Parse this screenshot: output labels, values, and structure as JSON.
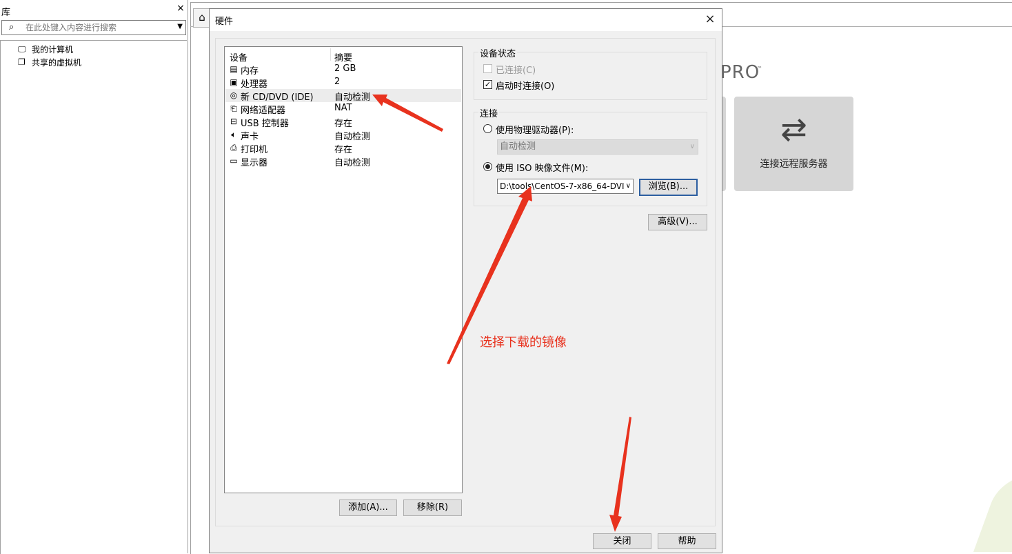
{
  "library": {
    "title": "库",
    "close": "×",
    "search_placeholder": "在此处键入内容进行搜索",
    "items": [
      {
        "label": "我的计算机",
        "icon": "monitor-icon"
      },
      {
        "label": "共享的虚拟机",
        "icon": "shared-vm-icon"
      }
    ]
  },
  "workstation": {
    "home_tab_icon": "home-icon",
    "pro_text": "PRO",
    "pro_tm": "™",
    "tiles": [
      {
        "label": "连接远程服务器",
        "icon": "swap-arrows-icon"
      }
    ]
  },
  "dialog": {
    "title": "硬件",
    "close": "×",
    "device_list": {
      "headers": {
        "device": "设备",
        "summary": "摘要"
      },
      "rows": [
        {
          "icon": "memory-icon",
          "name": "内存",
          "summary": "2 GB"
        },
        {
          "icon": "cpu-icon",
          "name": "处理器",
          "summary": "2"
        },
        {
          "icon": "cd-dvd-icon",
          "name": "新 CD/DVD (IDE)",
          "summary": "自动检测"
        },
        {
          "icon": "network-icon",
          "name": "网络适配器",
          "summary": "NAT"
        },
        {
          "icon": "usb-icon",
          "name": "USB 控制器",
          "summary": "存在"
        },
        {
          "icon": "sound-icon",
          "name": "声卡",
          "summary": "自动检测"
        },
        {
          "icon": "printer-icon",
          "name": "打印机",
          "summary": "存在"
        },
        {
          "icon": "display-icon",
          "name": "显示器",
          "summary": "自动检测"
        }
      ],
      "selected_index": 2
    },
    "add_button": "添加(A)...",
    "remove_button": "移除(R)",
    "device_status": {
      "label": "设备状态",
      "connected": {
        "label": "已连接(C)",
        "checked": false,
        "disabled": true
      },
      "connect_at_power_on": {
        "label": "启动时连接(O)",
        "checked": true
      }
    },
    "connection": {
      "label": "连接",
      "use_physical": {
        "label": "使用物理驱动器(P):",
        "selected": false
      },
      "physical_value": "自动检测",
      "use_iso": {
        "label": "使用 ISO 映像文件(M):",
        "selected": true
      },
      "iso_value": "D:\\tools\\CentOS-7-x86_64-DVI",
      "browse_button": "浏览(B)..."
    },
    "advanced_button": "高级(V)...",
    "close_button": "关闭",
    "help_button": "帮助"
  },
  "annotation": {
    "text": "选择下载的镜像",
    "color": "#e8321e"
  }
}
